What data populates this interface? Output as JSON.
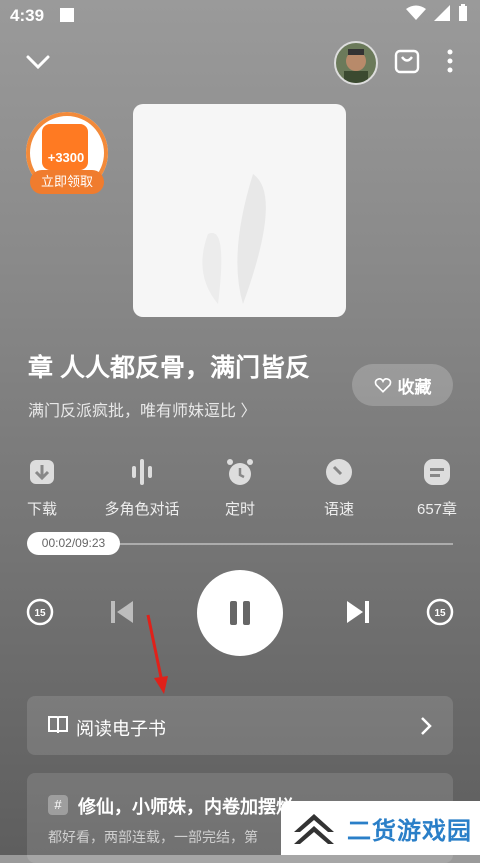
{
  "status_bar": {
    "time": "4:39"
  },
  "reward": {
    "amount": "+3300",
    "button_label": "立即领取"
  },
  "book": {
    "title": "章 人人都反骨，满门皆反",
    "subtitle": "满门反派疯批，唯有师妹逗比",
    "collect_label": "收藏"
  },
  "features": [
    {
      "label": "下载",
      "icon": "download-icon"
    },
    {
      "label": "多角色对话",
      "icon": "voice-wave-icon"
    },
    {
      "label": "定时",
      "icon": "alarm-icon"
    },
    {
      "label": "语速",
      "icon": "speed-icon"
    },
    {
      "label": "657章",
      "icon": "chapters-icon"
    }
  ],
  "player": {
    "time_display": "00:02/09:23",
    "progress": 0.0036
  },
  "read_ebook": {
    "label": "阅读电子书"
  },
  "recommend": {
    "title": "修仙，小师妹，内卷加摆烂",
    "subtitle": "都好看，两部连载，一部完结，第"
  },
  "watermark": {
    "text": "二货游戏园"
  },
  "colors": {
    "accent_orange": "#f07c2e",
    "watermark_blue": "#2a7fc8",
    "arrow_red": "#e0211a"
  }
}
